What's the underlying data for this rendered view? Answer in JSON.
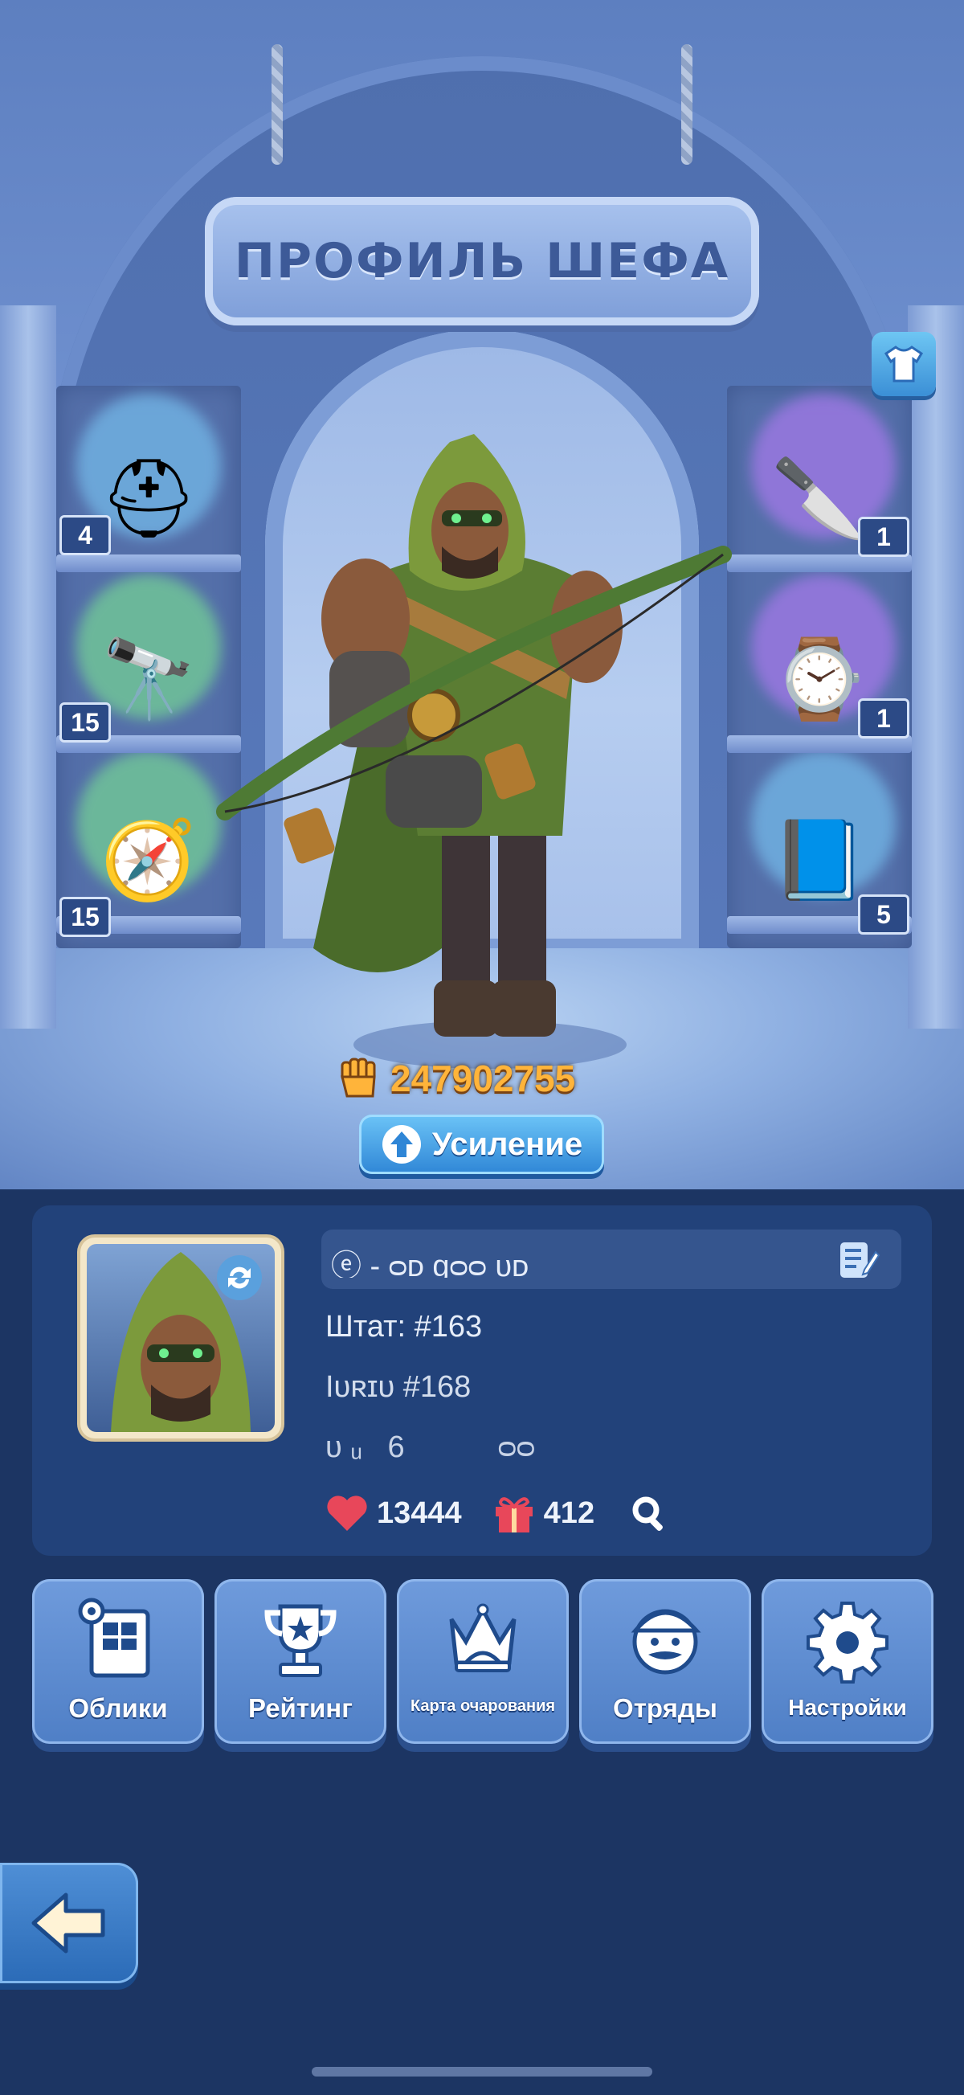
{
  "title": "ПРОФИЛЬ ШЕФА",
  "left_items": [
    {
      "icon": "aviator-helmet-icon",
      "glyph": "⛑",
      "count": "4"
    },
    {
      "icon": "binoculars-icon",
      "glyph": "🔭",
      "count": "15"
    },
    {
      "icon": "compass-icon",
      "glyph": "🧭",
      "count": "15"
    }
  ],
  "right_items": [
    {
      "icon": "knife-icon",
      "glyph": "🔪",
      "count": "1"
    },
    {
      "icon": "pocket-watch-icon",
      "glyph": "⌚",
      "count": "1"
    },
    {
      "icon": "spellbook-icon",
      "glyph": "📘",
      "count": "5"
    }
  ],
  "power": {
    "value": "247902755",
    "icon": "fist-icon"
  },
  "boost_button": {
    "label": "Усиление",
    "icon": "arrow-up-icon"
  },
  "profile": {
    "name": "ⓔ - ᴑᴅ ɡᴑᴑ ᴜᴅ",
    "state_label": "Штат: #163",
    "line2": "Iᴜʀɪᴜ #168",
    "line3": "ᴜ ᵤ   6           ᴑᴑ",
    "likes": "13444",
    "gifts": "412"
  },
  "menu": [
    {
      "label": "Облики",
      "icon": "skins-wardrobe-icon"
    },
    {
      "label": "Рейтинг",
      "icon": "trophy-icon"
    },
    {
      "label": "Карта очарования",
      "icon": "crown-icon"
    },
    {
      "label": "Отряды",
      "icon": "squad-face-icon"
    },
    {
      "label": "Настройки",
      "icon": "gear-icon"
    }
  ],
  "colors": {
    "accent": "#ffb43a",
    "panel": "#22427a",
    "background": "#1c3563",
    "button": "#4f7fc6"
  }
}
